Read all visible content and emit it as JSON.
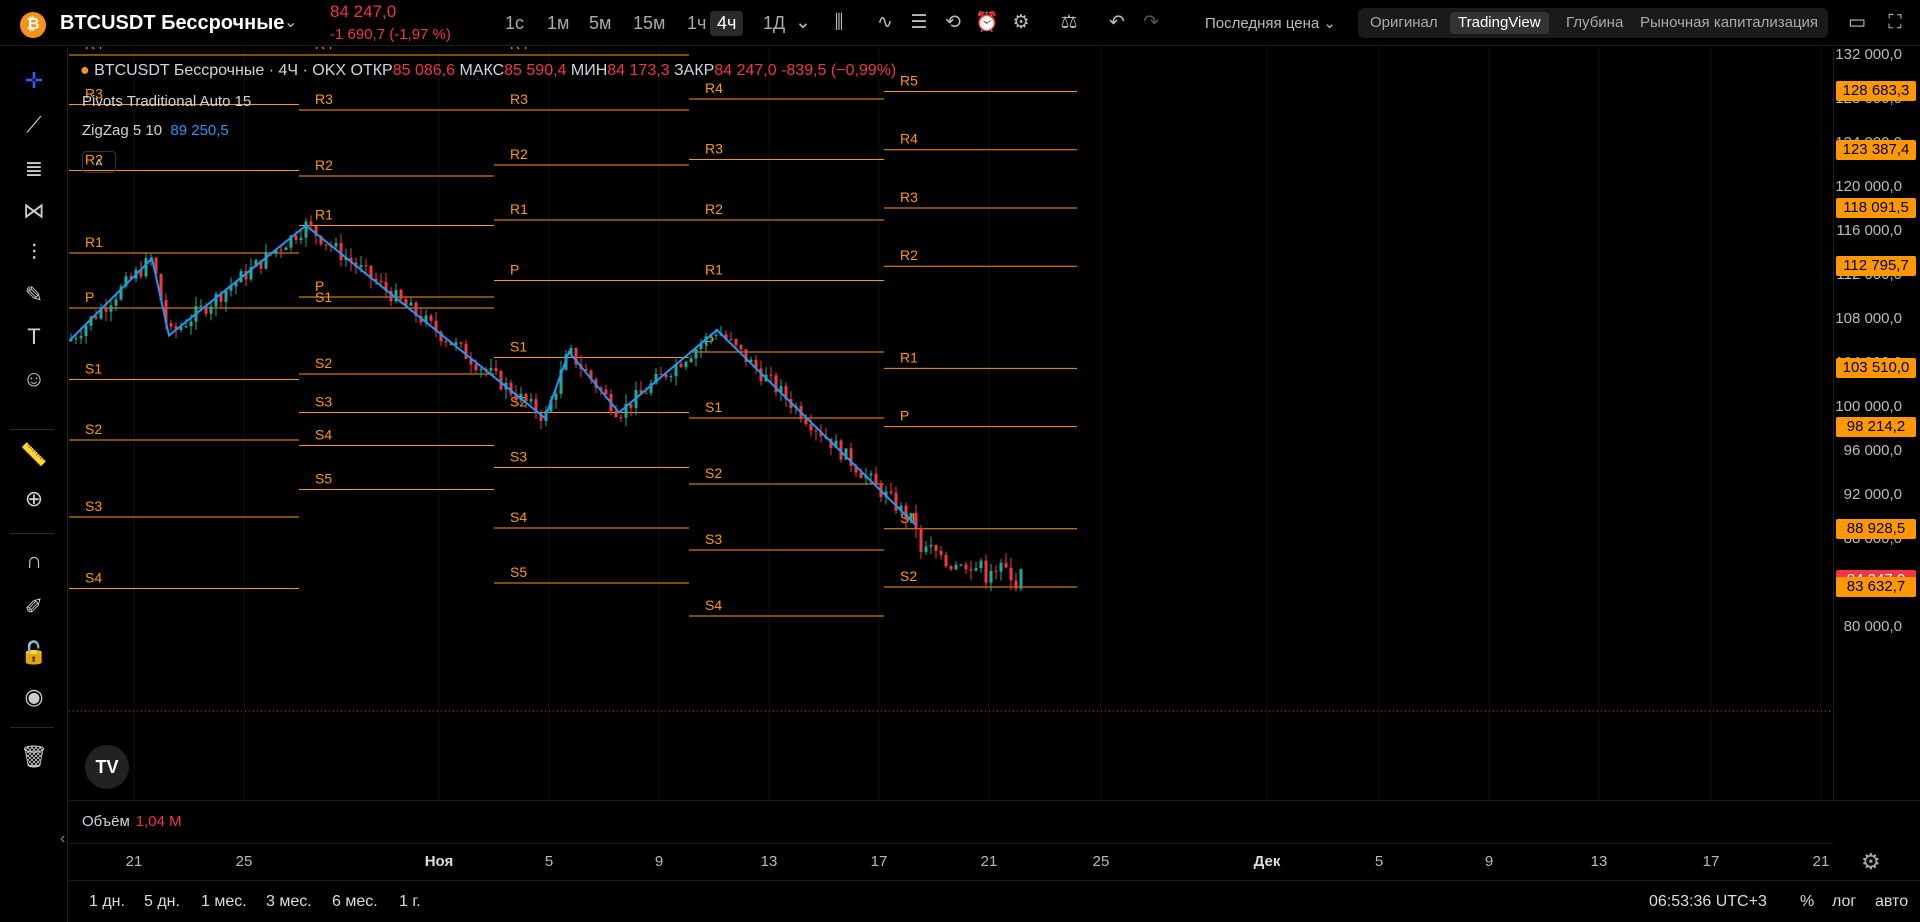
{
  "header": {
    "coin_glyph": "₿",
    "symbol": "BTCUSDT Бессрочные",
    "price": "84 247,0",
    "change": "-1 690,7 (-1,97 %)",
    "timeframes": [
      "1с",
      "1м",
      "5м",
      "15м",
      "1ч",
      "4ч",
      "1Д"
    ],
    "active_timeframe": "4ч",
    "last_price_label": "Последняя цена",
    "views": [
      "Оригинал",
      "TradingView",
      "Глубина",
      "Рыночная капитализация"
    ],
    "active_view": "TradingView"
  },
  "legend": {
    "symbol_line": "BTCUSDT Бессрочные · 4Ч · OKX",
    "open_label": "ОТКР",
    "open": "85 086,6",
    "high_label": "МАКС",
    "high": "85 590,4",
    "low_label": "МИН",
    "low": "84 173,3",
    "close_label": "ЗАКР",
    "close": "84 247,0",
    "change": "-839,5 (−0,99%)",
    "pivots": "Pivots Traditional Auto 15",
    "zigzag": "ZigZag 5 10",
    "zigzag_value": "89 250,5"
  },
  "volume": {
    "label": "Объём",
    "value": "1,04 M"
  },
  "price_axis": {
    "labels": [
      "132 000,0",
      "128 000,0",
      "124 000,0",
      "120 000,0",
      "116 000,0",
      "112 000,0",
      "108 000,0",
      "104 000,0",
      "100 000,0",
      "96 000,0",
      "92 000,0",
      "88 000,0",
      "80 000,0"
    ],
    "badges": [
      {
        "text": "128 683,3",
        "color": "#ff9800"
      },
      {
        "text": "123 387,4",
        "color": "#ff9800"
      },
      {
        "text": "118 091,5",
        "color": "#ff9800"
      },
      {
        "text": "112 795,7",
        "color": "#ff9800"
      },
      {
        "text": "103 510,0",
        "color": "#ff9800"
      },
      {
        "text": "98 214,2",
        "color": "#ff9800"
      },
      {
        "text": "88 928,5",
        "color": "#ff9800"
      },
      {
        "text": "84 247,0",
        "color": "#f23645"
      },
      {
        "text": "83 632,7",
        "color": "#ff9800"
      }
    ]
  },
  "time_axis": [
    "21",
    "25",
    "Ноя",
    "5",
    "9",
    "13",
    "17",
    "21",
    "25",
    "Дек",
    "5",
    "9",
    "13",
    "17",
    "21"
  ],
  "ranges": [
    "1 дн.",
    "5 дн.",
    "1 мес.",
    "3 мес.",
    "6 мес.",
    "1 г."
  ],
  "status": {
    "clock": "06:53:36 UTC+3",
    "percent": "%",
    "log": "лог",
    "auto": "авто"
  },
  "tv_logo": "TV",
  "colors": {
    "pivot": "#ff9800",
    "zigzag": "#2196f3",
    "up": "#22ab94",
    "down": "#f23645"
  },
  "chart_data": {
    "type": "candlestick",
    "pivot_levels": [
      {
        "period": 1,
        "P": 109000,
        "R1": 114000,
        "R2": 121500,
        "R3": 127500,
        "R4": 132000,
        "S1": 102500,
        "S2": 97000,
        "S3": 90000,
        "S4": 83500
      },
      {
        "period": 2,
        "P": 110000,
        "R1": 116500,
        "R2": 121000,
        "R3": 127000,
        "R4": 132000,
        "S1": 109000,
        "S2": 103000,
        "S3": 99500,
        "S4": 96500,
        "S5": 92500
      },
      {
        "period": 3,
        "P": 111500,
        "R1": 117000,
        "R2": 122000,
        "R3": 127000,
        "R4": 132000,
        "S1": 104500,
        "S2": 99500,
        "S3": 94500,
        "S4": 89000,
        "S5": 84000
      },
      {
        "period": 4,
        "P": 105000,
        "R1": 111500,
        "R2": 117000,
        "R3": 122500,
        "R4": 128000,
        "S1": 99000,
        "S2": 93000,
        "S3": 87000,
        "S4": 81000
      },
      {
        "period": 5,
        "P": 98214.2,
        "R1": 103510,
        "R2": 112795.7,
        "R3": 118091.5,
        "R4": 123387.4,
        "R5": 128683.3,
        "S1": 88928.5,
        "S2": 83632.7
      }
    ],
    "zigzag": [
      106000,
      113500,
      106500,
      116500,
      99000,
      105000,
      99500,
      107000,
      89250.5
    ],
    "price_range": [
      78000,
      133000
    ],
    "last_price": 84247.0
  }
}
